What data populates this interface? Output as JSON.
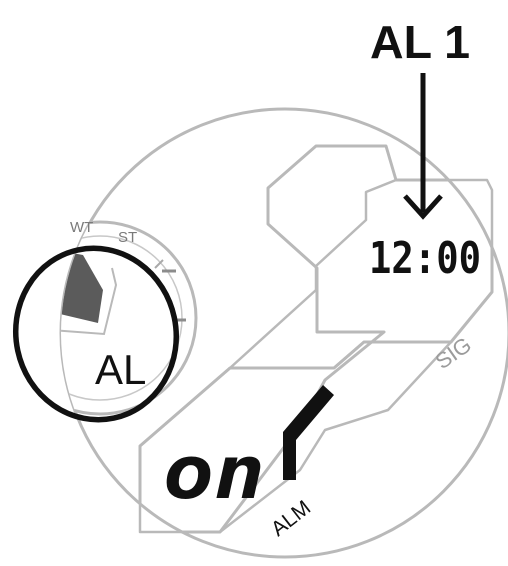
{
  "callout": {
    "label": "AL 1"
  },
  "subdial": {
    "mode_labels": [
      "WT",
      "ST"
    ],
    "selected_mode": "AL"
  },
  "display": {
    "time": "12:00",
    "alarm_state": "on",
    "alarm_indicator": "ALM",
    "signal_indicator": "SIG"
  },
  "colors": {
    "outline": "#b9b9b9",
    "ink": "#111111",
    "hand": "#5b5b5b",
    "muted_text": "#9b9b9b"
  }
}
